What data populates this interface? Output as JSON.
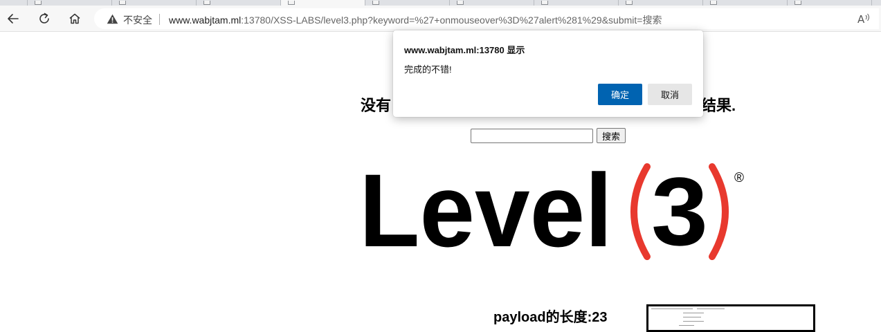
{
  "browser": {
    "insecure_label": "不安全",
    "url_host": "www.wabjtam.ml",
    "url_rest": ":13780/XSS-LABS/level3.php?keyword=%27+onmouseover%3D%27alert%281%29&submit=搜索",
    "read_aloud": "A̅",
    "icons": {
      "back": "back-arrow-icon",
      "reload": "reload-icon",
      "home": "home-icon",
      "warning": "warning-icon",
      "read_aloud": "read-aloud-icon"
    }
  },
  "page": {
    "heading_start": "没有",
    "heading_end": "结果.",
    "search_value": "",
    "search_button": "搜索",
    "payload_length": "payload的长度:23"
  },
  "logo": {
    "word": "Level",
    "number": "3",
    "registered": "®",
    "accent_color": "#e8392e",
    "text_color": "#000000"
  },
  "dialog": {
    "title": "www.wabjtam.ml:13780 显示",
    "message": "完成的不错!",
    "ok_label": "确定",
    "cancel_label": "取消",
    "ok_color": "#0063b1"
  }
}
